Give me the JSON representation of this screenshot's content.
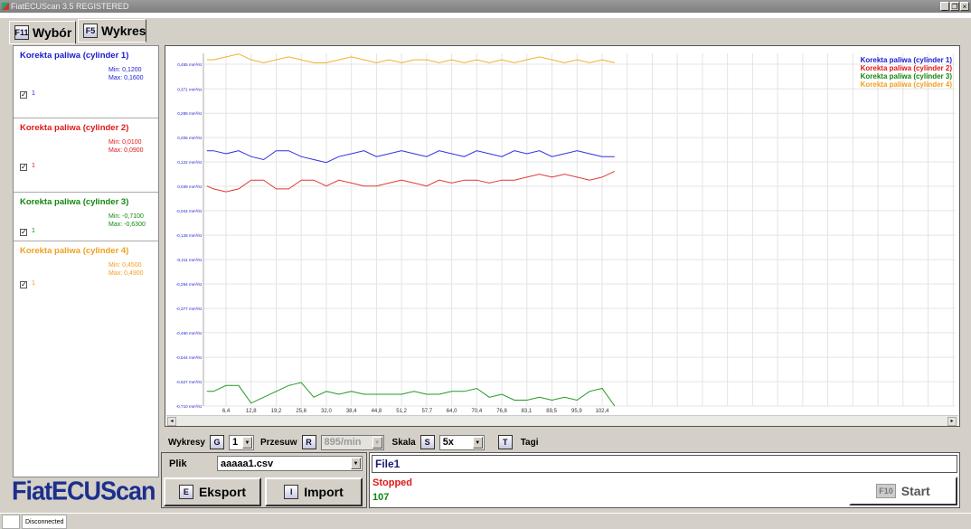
{
  "window": {
    "title": "FiatECUScan 3.5 REGISTERED",
    "minimize": "_",
    "restore": "❐",
    "close": "×"
  },
  "tabs": [
    {
      "key": "F11",
      "label": "Wybór"
    },
    {
      "key": "F5",
      "label": "Wykres"
    }
  ],
  "channels": [
    {
      "title": "Korekta paliwa (cylinder 1)",
      "min": "Min: 0,1200",
      "max": "Max: 0,1600",
      "checked": "✓",
      "num": "1",
      "color": "#1a1ad0"
    },
    {
      "title": "Korekta paliwa (cylinder 2)",
      "min": "Min: 0,0100",
      "max": "Max: 0,0900",
      "checked": "✓",
      "num": "1",
      "color": "#e01818"
    },
    {
      "title": "Korekta paliwa (cylinder 3)",
      "min": "Min: -0,7100",
      "max": "Max: -0,6300",
      "checked": "✓",
      "num": "1",
      "color": "#118811"
    },
    {
      "title": "Korekta paliwa (cylinder 4)",
      "min": "Min: 0,4500",
      "max": "Max: 0,4900",
      "checked": "✓",
      "num": "1",
      "color": "#f0a020"
    }
  ],
  "logo": "FiatECUScan",
  "chart_data": {
    "type": "line",
    "unit": "mm³/st",
    "ylim": [
      -0.71,
      0.492
    ],
    "y_ticks": [
      0.455,
      0.371,
      0.288,
      0.205,
      0.122,
      0.039,
      -0.044,
      -0.128,
      -0.211,
      -0.294,
      -0.377,
      -0.46,
      -0.544,
      -0.627,
      -0.71
    ],
    "y_tick_labels": [
      "0,455",
      "0,371",
      "0,288",
      "0,205",
      "0,122",
      "0,039",
      "-0,044",
      "-0,128",
      "-0,211",
      "-0,294",
      "-0,377",
      "-0,460",
      "-0,544",
      "-0,627",
      "-0,710"
    ],
    "x_ticks": [
      6.4,
      12.8,
      19.2,
      25.6,
      32.0,
      38.4,
      44.8,
      51.2,
      57.7,
      64.0,
      70.4,
      76.8,
      83.1,
      89.5,
      95.9,
      102.4
    ],
    "x_tick_labels": [
      "6,4",
      "12,8",
      "19,2",
      "25,6",
      "32,0",
      "38,4",
      "44,8",
      "51,2",
      "57,7",
      "64,0",
      "70,4",
      "76,8",
      "83,1",
      "89,5",
      "95,9",
      "102,4"
    ],
    "x_step": 3.2,
    "legend_position": "top-right",
    "series": [
      {
        "name": "Korekta paliwa (cylinder 1)",
        "color": "#3030e0",
        "values": [
          0.16,
          0.16,
          0.15,
          0.16,
          0.14,
          0.13,
          0.16,
          0.16,
          0.14,
          0.13,
          0.12,
          0.14,
          0.15,
          0.16,
          0.14,
          0.15,
          0.16,
          0.15,
          0.14,
          0.16,
          0.15,
          0.14,
          0.16,
          0.15,
          0.14,
          0.16,
          0.15,
          0.16,
          0.14,
          0.15,
          0.16,
          0.15,
          0.14,
          0.14
        ]
      },
      {
        "name": "Korekta paliwa (cylinder 2)",
        "color": "#e03838",
        "values": [
          0.04,
          0.03,
          0.02,
          0.03,
          0.06,
          0.06,
          0.03,
          0.03,
          0.06,
          0.06,
          0.04,
          0.06,
          0.05,
          0.04,
          0.04,
          0.05,
          0.06,
          0.05,
          0.04,
          0.06,
          0.05,
          0.06,
          0.06,
          0.05,
          0.06,
          0.06,
          0.07,
          0.08,
          0.07,
          0.08,
          0.07,
          0.06,
          0.07,
          0.09
        ]
      },
      {
        "name": "Korekta paliwa (cylinder 3)",
        "color": "#229922",
        "values": [
          -0.66,
          -0.66,
          -0.64,
          -0.64,
          -0.7,
          -0.68,
          -0.66,
          -0.64,
          -0.63,
          -0.68,
          -0.66,
          -0.67,
          -0.66,
          -0.67,
          -0.67,
          -0.67,
          -0.67,
          -0.66,
          -0.67,
          -0.67,
          -0.66,
          -0.66,
          -0.65,
          -0.68,
          -0.67,
          -0.69,
          -0.69,
          -0.68,
          -0.69,
          -0.68,
          -0.69,
          -0.66,
          -0.65,
          -0.71
        ]
      },
      {
        "name": "Korekta paliwa (cylinder 4)",
        "color": "#f0b030",
        "values": [
          0.47,
          0.47,
          0.48,
          0.49,
          0.47,
          0.46,
          0.47,
          0.48,
          0.47,
          0.46,
          0.46,
          0.47,
          0.48,
          0.47,
          0.46,
          0.47,
          0.46,
          0.47,
          0.47,
          0.46,
          0.47,
          0.46,
          0.47,
          0.46,
          0.47,
          0.46,
          0.47,
          0.48,
          0.47,
          0.46,
          0.47,
          0.46,
          0.47,
          0.46
        ]
      }
    ]
  },
  "controls": {
    "wykresy": "Wykresy",
    "g": "G",
    "g_val": "1",
    "przesuw": "Przesuw",
    "r": "R",
    "r_val": "895/min",
    "skala": "Skala",
    "s": "S",
    "s_val": "5x",
    "t": "T",
    "tagi": "Tagi"
  },
  "file": {
    "label": "Plik",
    "value": "aaaaa1.csv",
    "export_key": "E",
    "export": "Eksport",
    "import_key": "I",
    "import": "Import"
  },
  "status": {
    "name": "File1",
    "state": "Stopped",
    "count": "107",
    "start_key": "F10",
    "start": "Start"
  },
  "statusbar": {
    "connection": "Disconnected"
  }
}
